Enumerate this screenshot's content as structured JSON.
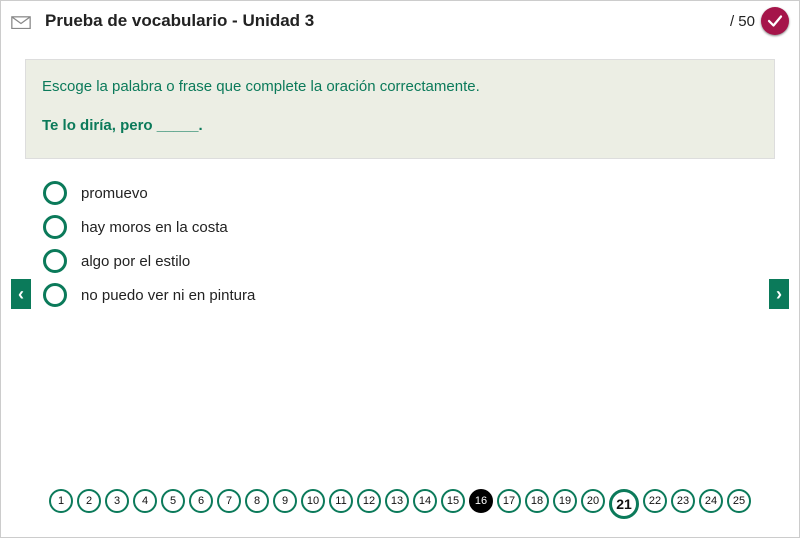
{
  "header": {
    "title": "Prueba de vocabulario - Unidad 3",
    "score_label": "/ 50"
  },
  "question": {
    "instruction": "Escoge la palabra o frase que complete la oración correctamente.",
    "prompt": "Te lo diría, pero _____."
  },
  "options": [
    "promuevo",
    "hay moros en la costa",
    "algo por el estilo",
    "no puedo ver ni en pintura"
  ],
  "nav": {
    "prev_glyph": "‹",
    "next_glyph": "›"
  },
  "pager": {
    "items": [
      "1",
      "2",
      "3",
      "4",
      "5",
      "6",
      "7",
      "8",
      "9",
      "10",
      "11",
      "12",
      "13",
      "14",
      "15",
      "16",
      "17",
      "18",
      "19",
      "20",
      "21",
      "22",
      "23",
      "24",
      "25"
    ],
    "active_index": 15,
    "next_index": 20
  }
}
